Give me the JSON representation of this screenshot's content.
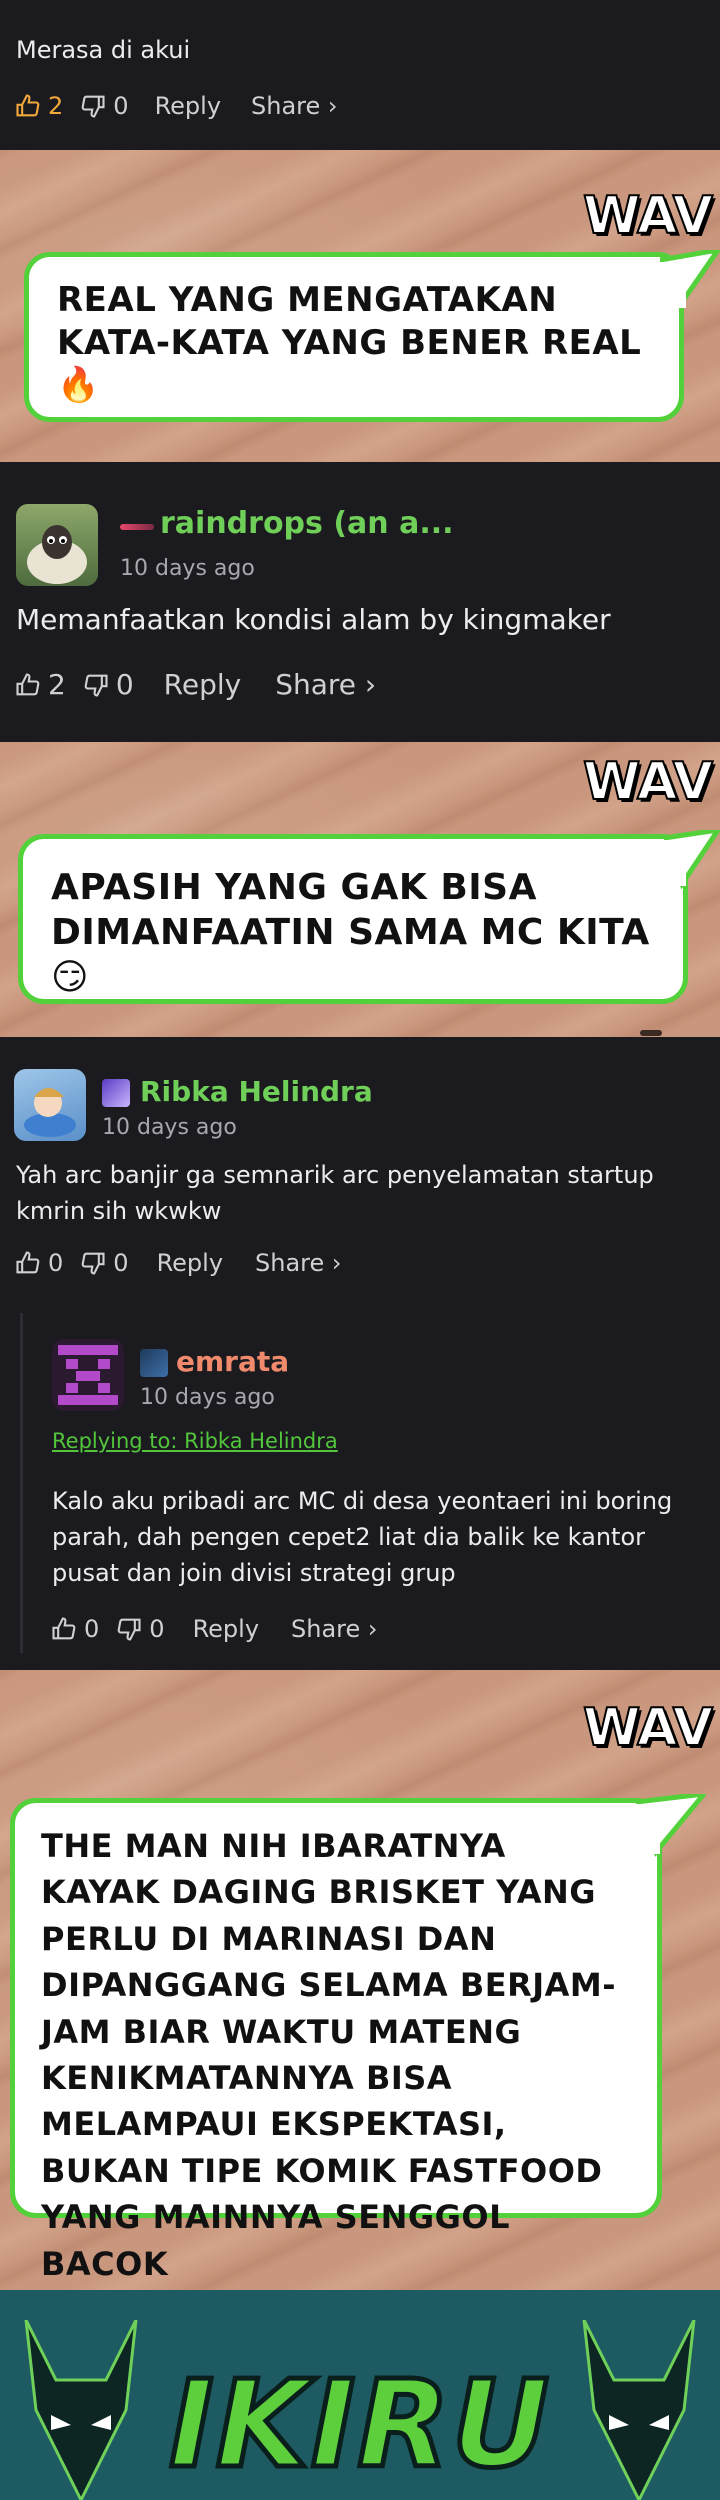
{
  "comments": [
    {
      "user": "",
      "time": "",
      "text": "Merasa di akui",
      "likes": "2",
      "dislikes": "0",
      "reply": "Reply",
      "share": "Share ›"
    },
    {
      "user": "raindrops (an a...",
      "time": "10 days ago",
      "text": "Memanfaatkan kondisi alam by kingmaker",
      "likes": "2",
      "dislikes": "0",
      "reply": "Reply",
      "share": "Share ›"
    },
    {
      "user": "Ribka Helindra",
      "time": "10 days ago",
      "text": "Yah arc banjir ga semnarik arc penyelamatan startup kmrin sih wkwkw",
      "likes": "0",
      "dislikes": "0",
      "reply": "Reply",
      "share": "Share ›"
    },
    {
      "user": "emrata",
      "time": "10 days ago",
      "replying": "Replying to: Ribka Helindra",
      "text": "Kalo aku pribadi arc MC di desa yeontaeri ini boring parah, dah pengen cepet2 liat dia balik ke kantor pusat dan join divisi strategi grup",
      "likes": "0",
      "dislikes": "0",
      "reply": "Reply",
      "share": "Share ›"
    }
  ],
  "panels": [
    {
      "brand": "WAV",
      "bubble": "REAL YANG MENGATAKAN KATA-KATA YANG BENER REAL 🔥"
    },
    {
      "brand": "WAV",
      "bubble": "APASIH YANG GAK BISA DIMANFAATIN SAMA MC KITA 😏"
    },
    {
      "brand": "WAV",
      "bubble": "THE MAN NIH IBARATNYA KAYAK DAGING BRISKET YANG PERLU DI MARINASI DAN DIPANGGANG SELAMA BERJAM-JAM BIAR WAKTU MATENG KENIKMATANNYA BISA MELAMPAUI EKSPEKTASI, BUKAN TIPE KOMIK FASTFOOD YANG MAINNYA SENGGOL BACOK"
    }
  ],
  "footer": {
    "logo": "IKIRU"
  },
  "colors": {
    "accent_green": "#52d13b",
    "username_green": "#6fcf58",
    "emrata_color": "#f08a6c",
    "like_orange": "#f2a93b"
  }
}
